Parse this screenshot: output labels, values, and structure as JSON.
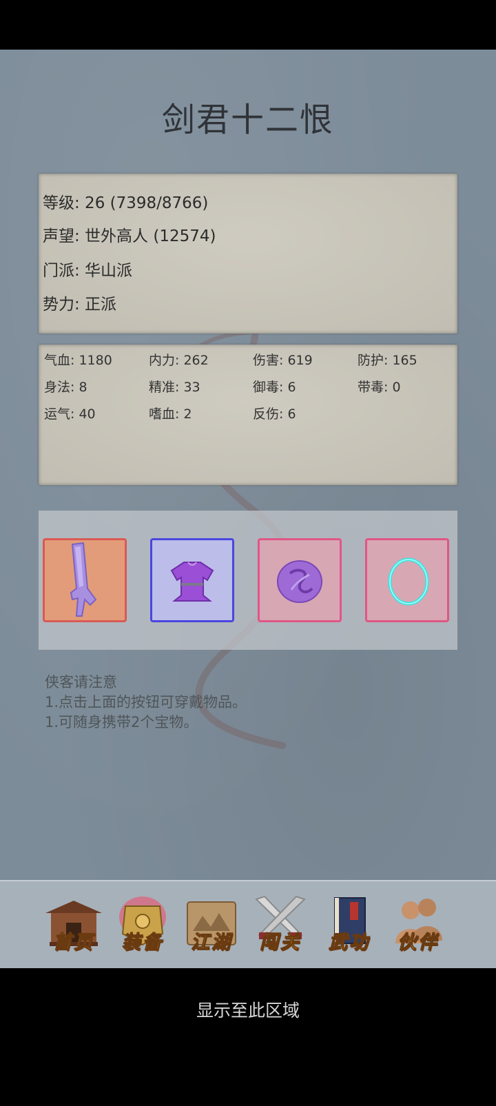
{
  "character": {
    "name": "剑君十二恨"
  },
  "info": {
    "level": "等级: 26 (7398/8766)",
    "reputation": "声望: 世外高人 (12574)",
    "sect": "门派: 华山派",
    "faction": "势力:  正派"
  },
  "stats": [
    "气血: 1180",
    "内力: 262",
    "伤害: 619",
    "防护: 165",
    "身法: 8",
    "精准: 33",
    "御毒: 6",
    "带毒: 0",
    "运气: 40",
    "嗜血: 2",
    "反伤: 6"
  ],
  "equipment": {
    "slots": [
      {
        "icon": "sword-icon",
        "border": "#d95a55"
      },
      {
        "icon": "armor-icon",
        "border": "#4a46e0"
      },
      {
        "icon": "talisman-icon",
        "border": "#e05686"
      },
      {
        "icon": "ring-icon",
        "border": "#e05686"
      }
    ]
  },
  "notes": {
    "title": "侠客请注意",
    "line1": "1.点击上面的按钮可穿戴物品。",
    "line2": "1.可随身携带2个宝物。"
  },
  "nav": {
    "items": [
      {
        "label": "首页",
        "icon": "temple-icon"
      },
      {
        "label": "装备",
        "icon": "armor-icon"
      },
      {
        "label": "江湖",
        "icon": "scroll-map-icon"
      },
      {
        "label": "闯关",
        "icon": "crossed-swords-icon"
      },
      {
        "label": "武功",
        "icon": "book-icon"
      },
      {
        "label": "伙伴",
        "icon": "people-icon"
      }
    ]
  },
  "footer": {
    "display_text": "显示至此区域"
  },
  "colors": {
    "background": "#7d8c99",
    "paper": "#c9c5b9",
    "nav_bar": "#a7b1ba",
    "nav_label": "#f2c432"
  }
}
